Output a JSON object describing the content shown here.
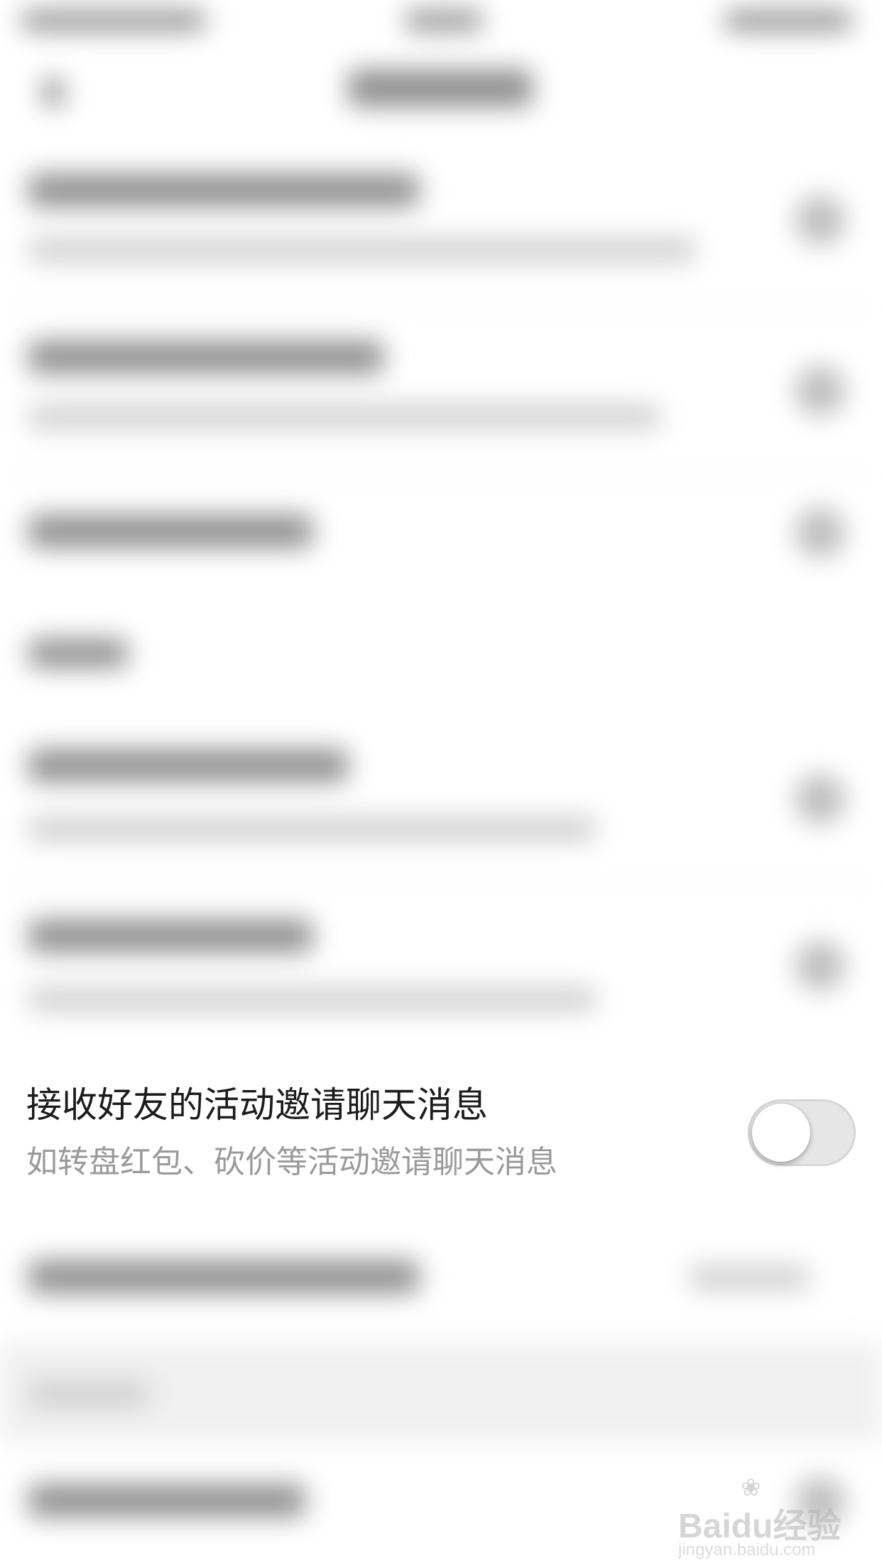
{
  "focused_setting": {
    "title": "接收好友的活动邀请聊天消息",
    "subtitle": "如转盘红包、砍价等活动邀请聊天消息",
    "enabled": false
  },
  "watermark": {
    "brand": "Baidu经验",
    "url": "jingyan.baidu.com"
  }
}
